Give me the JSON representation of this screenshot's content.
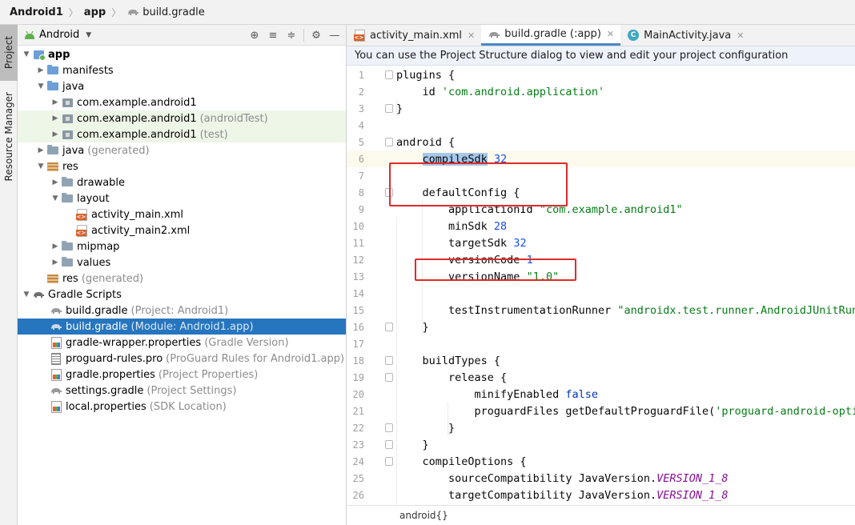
{
  "breadcrumb": [
    "Android1",
    "app",
    "build.gradle"
  ],
  "tool_strip": {
    "project": "Project",
    "resource_manager": "Resource Manager"
  },
  "project_panel": {
    "view_name": "Android",
    "tree": [
      {
        "label": "app",
        "secondary": ""
      },
      {
        "label": "manifests",
        "secondary": ""
      },
      {
        "label": "java",
        "secondary": ""
      },
      {
        "label": "com.example.android1",
        "secondary": ""
      },
      {
        "label": "com.example.android1",
        "secondary": "(androidTest)"
      },
      {
        "label": "com.example.android1",
        "secondary": "(test)"
      },
      {
        "label": "java",
        "secondary": "(generated)"
      },
      {
        "label": "res",
        "secondary": ""
      },
      {
        "label": "drawable",
        "secondary": ""
      },
      {
        "label": "layout",
        "secondary": ""
      },
      {
        "label": "activity_main.xml",
        "secondary": ""
      },
      {
        "label": "activity_main2.xml",
        "secondary": ""
      },
      {
        "label": "mipmap",
        "secondary": ""
      },
      {
        "label": "values",
        "secondary": ""
      },
      {
        "label": "res",
        "secondary": "(generated)"
      },
      {
        "label": "Gradle Scripts",
        "secondary": ""
      },
      {
        "label": "build.gradle",
        "secondary": "(Project: Android1)"
      },
      {
        "label": "build.gradle",
        "secondary": "(Module: Android1.app)"
      },
      {
        "label": "gradle-wrapper.properties",
        "secondary": "(Gradle Version)"
      },
      {
        "label": "proguard-rules.pro",
        "secondary": "(ProGuard Rules for Android1.app)"
      },
      {
        "label": "gradle.properties",
        "secondary": "(Project Properties)"
      },
      {
        "label": "settings.gradle",
        "secondary": "(Project Settings)"
      },
      {
        "label": "local.properties",
        "secondary": "(SDK Location)"
      }
    ]
  },
  "editor": {
    "tabs": [
      {
        "label": "activity_main.xml"
      },
      {
        "label": "build.gradle (:app)"
      },
      {
        "label": "MainActivity.java"
      }
    ],
    "banner": "You can use the Project Structure dialog to view and edit your project configuration",
    "line_numbers": [
      "1",
      "2",
      "3",
      "4",
      "5",
      "6",
      "7",
      "8",
      "9",
      "10",
      "11",
      "12",
      "13",
      "14",
      "15",
      "16",
      "17",
      "18",
      "19",
      "20",
      "21",
      "22",
      "23",
      "24",
      "25",
      "26"
    ],
    "code": {
      "l1": "plugins {",
      "l2_a": "    id ",
      "l2_b": "'com.android.application'",
      "l3": "}",
      "l5": "android {",
      "l6_a": "compileSdk",
      "l6_b": "32",
      "l8": "    defaultConfig {",
      "l9_a": "        applicationId ",
      "l9_b": "\"com.example.android1\"",
      "l10_a": "        minSdk ",
      "l10_b": "28",
      "l11_a": "        targetSdk ",
      "l11_b": "32",
      "l12_a": "        versionCode ",
      "l12_b": "1",
      "l13_a": "        versionName ",
      "l13_b": "\"1.0\"",
      "l15_a": "        testInstrumentationRunner ",
      "l15_b": "\"androidx.test.runner.AndroidJUnitRunner\"",
      "l16": "    }",
      "l18": "    buildTypes {",
      "l19": "        release {",
      "l20_a": "            minifyEnabled ",
      "l20_b": "false",
      "l21_a": "            proguardFiles getDefaultProguardFile(",
      "l21_b": "'proguard-android-optimize.txt'",
      "l22": "        }",
      "l23": "    }",
      "l24": "    compileOptions {",
      "l25_a": "        sourceCompatibility JavaVersion.",
      "l25_b": "VERSION_1_8",
      "l26_a": "        targetCompatibility JavaVersion.",
      "l26_b": "VERSION_1_8"
    },
    "status_crumb": "android{}"
  },
  "colors": {
    "selection": "#2675bf",
    "red_box": "#e02a2a",
    "string": "#067d17",
    "number": "#1750eb"
  }
}
